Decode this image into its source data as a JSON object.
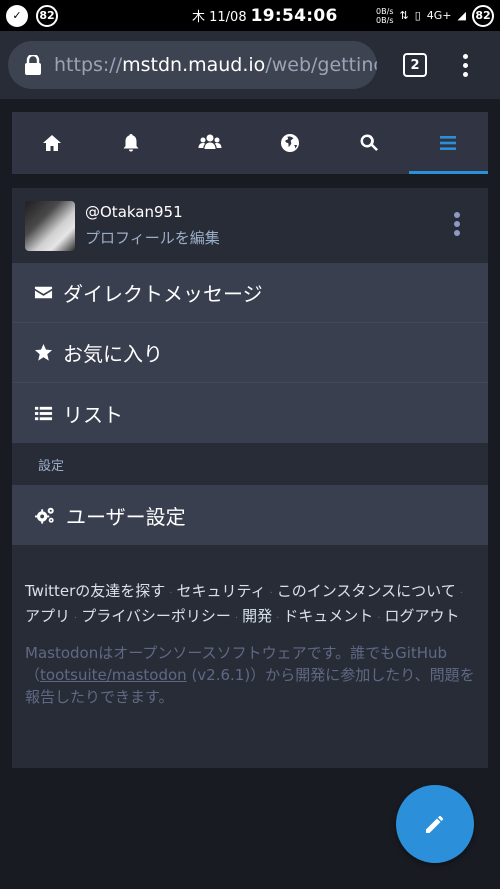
{
  "status_bar": {
    "badge_left": "82",
    "date": "木 11/08",
    "time": "19:54:06",
    "net_up": "0B/s",
    "net_down": "0B/s",
    "network": "4G+",
    "battery": "82"
  },
  "browser": {
    "url_scheme": "https://",
    "url_domain": "mstdn.maud.io",
    "url_path": "/web/getting-started",
    "tab_count": "2"
  },
  "nav": {
    "tabs": [
      {
        "icon": "home-icon"
      },
      {
        "icon": "bell-icon"
      },
      {
        "icon": "users-icon"
      },
      {
        "icon": "globe-icon"
      },
      {
        "icon": "search-icon"
      },
      {
        "icon": "bars-icon",
        "active": true
      }
    ],
    "accent": "#2b90d9"
  },
  "account": {
    "handle": "@Otakan951",
    "edit_profile": "プロフィールを編集"
  },
  "menu": {
    "direct_messages": "ダイレクトメッセージ",
    "favourites": "お気に入り",
    "lists": "リスト",
    "settings_header": "設定",
    "user_settings": "ユーザー設定"
  },
  "footer": {
    "links": [
      "Twitterの友達を探す",
      "セキュリティ",
      "このインスタンスについて",
      "アプリ",
      "プライバシーポリシー",
      "開発",
      "ドキュメント",
      "ログアウト"
    ],
    "about_prefix": "Mastodonはオープンソースソフトウェアです。誰でもGitHub（",
    "about_repo": "tootsuite/mastodon",
    "about_version": " (v2.6.1)",
    "about_suffix": "）から開発に参加したり、問題を報告したりできます。"
  }
}
